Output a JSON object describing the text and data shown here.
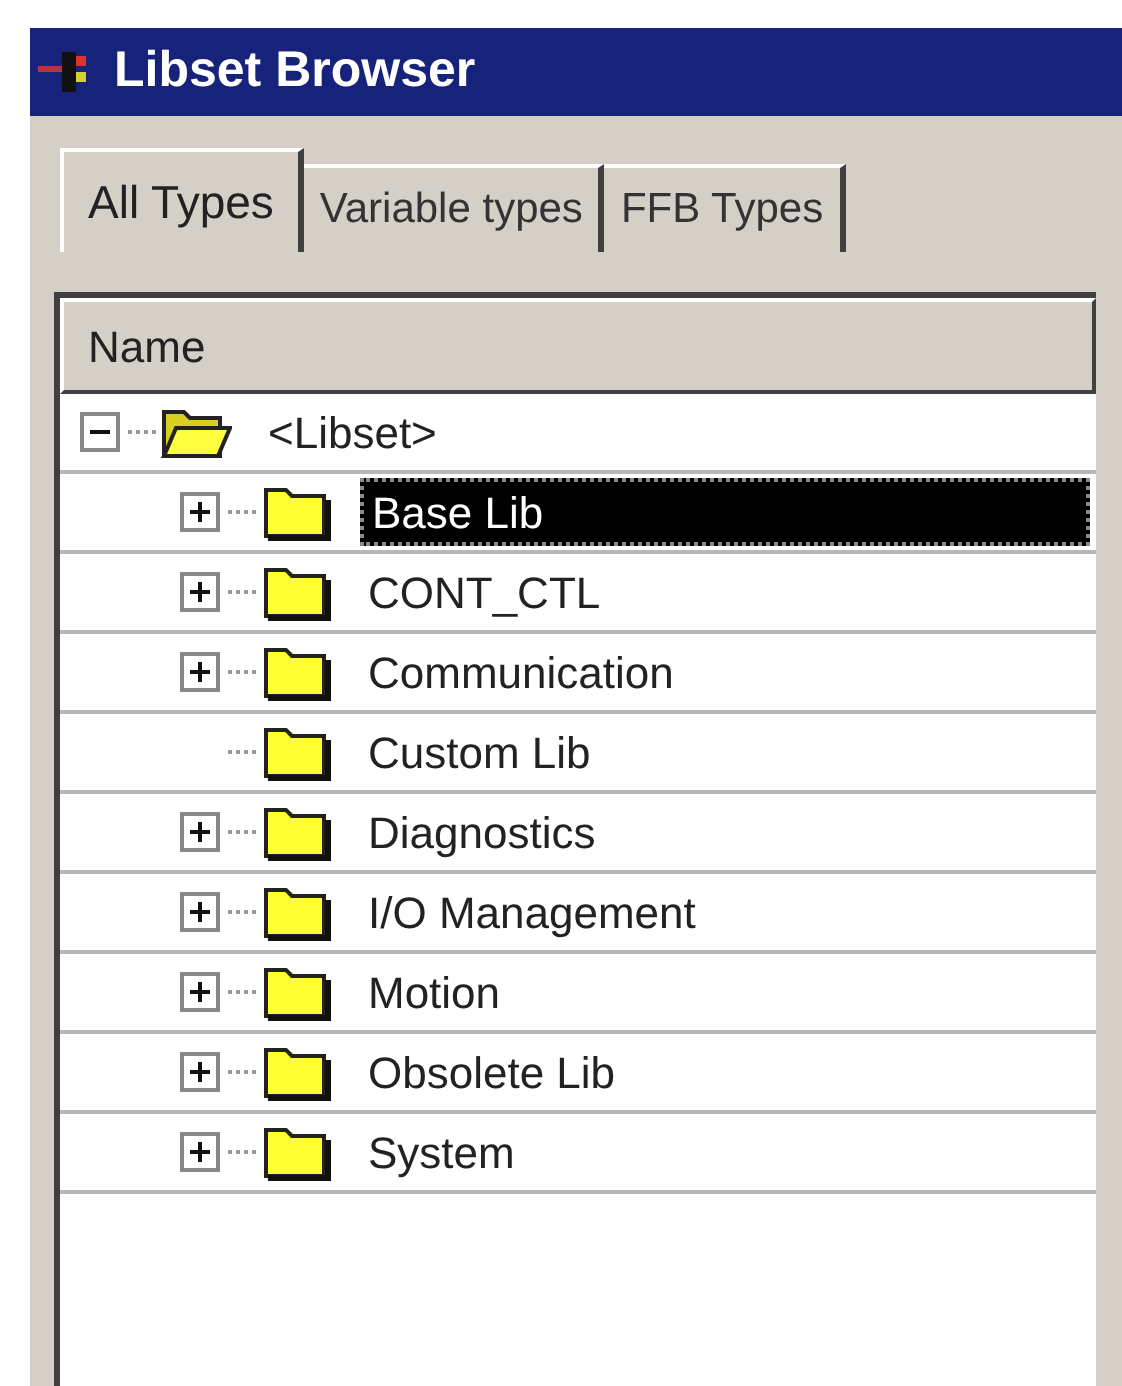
{
  "window": {
    "title": "Libset Browser"
  },
  "tabs": [
    {
      "label": "All Types",
      "selected": true
    },
    {
      "label": "Variable types",
      "selected": false
    },
    {
      "label": "FFB Types",
      "selected": false
    }
  ],
  "tree": {
    "column": "Name",
    "root": {
      "label": "<Libset>",
      "expanded": true,
      "selected": false,
      "children": [
        {
          "label": "Base Lib",
          "has_children": true,
          "expanded": false,
          "selected": true
        },
        {
          "label": "CONT_CTL",
          "has_children": true,
          "expanded": false,
          "selected": false
        },
        {
          "label": "Communication",
          "has_children": true,
          "expanded": false,
          "selected": false
        },
        {
          "label": "Custom Lib",
          "has_children": false,
          "selected": false
        },
        {
          "label": "Diagnostics",
          "has_children": true,
          "expanded": false,
          "selected": false
        },
        {
          "label": "I/O Management",
          "has_children": true,
          "expanded": false,
          "selected": false
        },
        {
          "label": "Motion",
          "has_children": true,
          "expanded": false,
          "selected": false
        },
        {
          "label": "Obsolete Lib",
          "has_children": true,
          "expanded": false,
          "selected": false
        },
        {
          "label": "System",
          "has_children": true,
          "expanded": false,
          "selected": false
        }
      ]
    }
  }
}
